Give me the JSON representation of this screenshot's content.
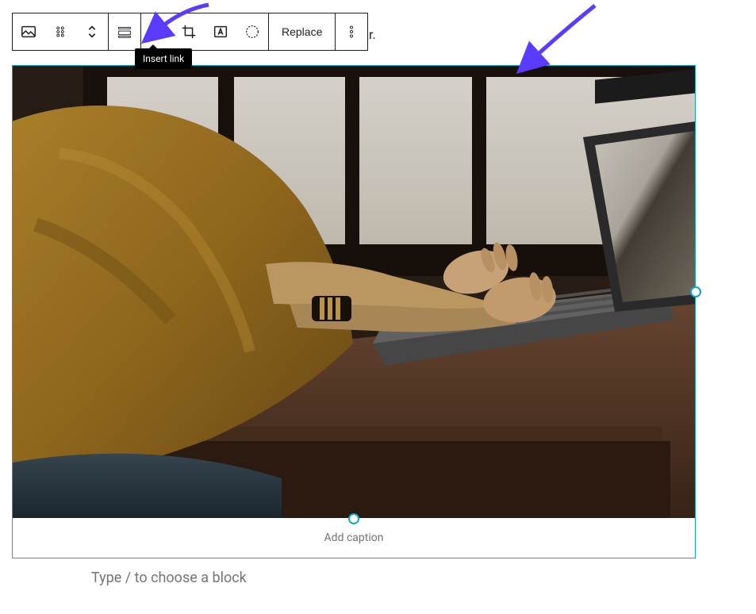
{
  "toolbar": {
    "block_icon_name": "image-block-icon",
    "drag_icon_name": "drag-handle-icon",
    "move_icon_name": "move-updown-icon",
    "align_icon_name": "align-icon",
    "link_icon_name": "link-icon",
    "crop_icon_name": "crop-icon",
    "text_overlay_icon_name": "text-overlay-icon",
    "duotone_icon_name": "duotone-icon",
    "replace_label": "Replace",
    "more_icon_name": "more-options-icon"
  },
  "tooltip": {
    "text": "Insert link"
  },
  "stray_text": "r.",
  "image_block": {
    "caption_placeholder": "Add caption",
    "alt": "Person in mustard sweater typing on a laptop at a wooden desk"
  },
  "block_prompt": "Type / to choose a block",
  "annotations": {
    "arrow_color": "#5b3cff"
  }
}
